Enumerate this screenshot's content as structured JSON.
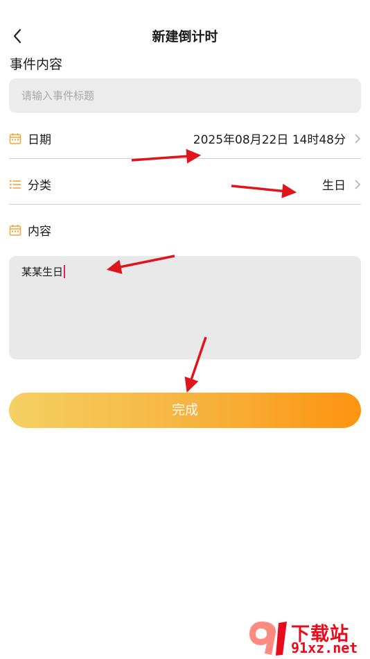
{
  "header": {
    "title": "新建倒计时"
  },
  "event": {
    "label": "事件内容",
    "placeholder": "请输入事件标题",
    "value": ""
  },
  "date_row": {
    "label": "日期",
    "value": "2025年08月22日 14时48分"
  },
  "category_row": {
    "label": "分类",
    "value": "生日"
  },
  "content_row": {
    "label": "内容"
  },
  "content_text": "某某生日",
  "done_button": "完成",
  "watermark": {
    "top": "下载站",
    "bottom": "91xz.net"
  },
  "colors": {
    "accent": "#f2a43b",
    "gradient_start": "#f5d063",
    "gradient_end": "#fd9410",
    "annotation": "#e0141c",
    "caret": "#e0245e"
  },
  "icons": {
    "back": "chevron-left-icon",
    "calendar": "calendar-icon",
    "list": "list-icon",
    "chevron": "chevron-right-icon"
  }
}
